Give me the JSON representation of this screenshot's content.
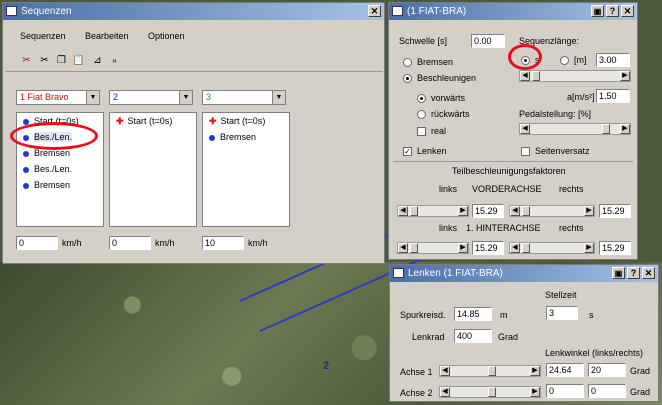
{
  "sequenzen": {
    "title": "Sequenzen",
    "menu": [
      "Sequenzen",
      "Bearbeiten",
      "Optionen"
    ],
    "columns": [
      {
        "vehicle": "1 Fiat Bravo",
        "items": [
          "Start (t=0s)",
          "Bes./Len.",
          "Bremsen",
          "Bes./Len.",
          "Bremsen"
        ],
        "speed": "0",
        "unit": "km/h"
      },
      {
        "vehicle": "2",
        "items": [
          "Start (t=0s)"
        ],
        "speed": "0",
        "unit": "km/h"
      },
      {
        "vehicle": "3",
        "items": [
          "Start (t=0s)",
          "Bremsen"
        ],
        "speed": "10",
        "unit": "km/h"
      }
    ]
  },
  "beschl": {
    "title": "(1 FIAT-BRA)",
    "schwelle_label": "Schwelle [s]",
    "schwelle_value": "0.00",
    "bremsen_label": "Bremsen",
    "beschleunigen_label": "Beschleunigen",
    "vorwaerts_label": "vorwärts",
    "rueckwaerts_label": "rückwärts",
    "real_label": "real",
    "lenken_label": "Lenken",
    "sequenzlaenge_label": "Sequenzlänge:",
    "opt_s_label": "s",
    "opt_m_label": "[m]",
    "sequenzlaenge_value": "3.00",
    "a_label": "a[m/s²]",
    "a_value": "1.50",
    "pedal_label": "Pedalstellung: [%]",
    "seitenversatz_label": "Seitenversatz",
    "teilbeschl_label": "Teilbeschleunigungsfaktoren",
    "links_label": "links",
    "rechts_label": "rechts",
    "vorderachse_label": "VORDERACHSE",
    "hinterachse_label": "1. HINTERACHSE",
    "va_left": "15.29",
    "va_right": "15.29",
    "ha_left": "15.29",
    "ha_right": "15.29"
  },
  "lenken": {
    "title": "Lenken (1 FIAT-BRA)",
    "stellzeit_label": "Stellzeit",
    "stellzeit_value": "3",
    "stellzeit_unit": "s",
    "spurkreisd_label": "Spurkreisd.",
    "spurkreisd_value": "14.85",
    "spurkreisd_unit": "m",
    "lenkrad_label": "Lenkrad",
    "lenkrad_value": "400",
    "lenkrad_unit": "Grad",
    "lenkwinkel_label": "Lenkwinkel (links/rechts)",
    "achse1_label": "Achse 1",
    "achse1_left": "24.64",
    "achse1_right": "20",
    "achse2_label": "Achse 2",
    "achse2_left": "0",
    "achse2_right": "0",
    "grad_label": "Grad"
  },
  "background": {
    "road_number": "2"
  }
}
